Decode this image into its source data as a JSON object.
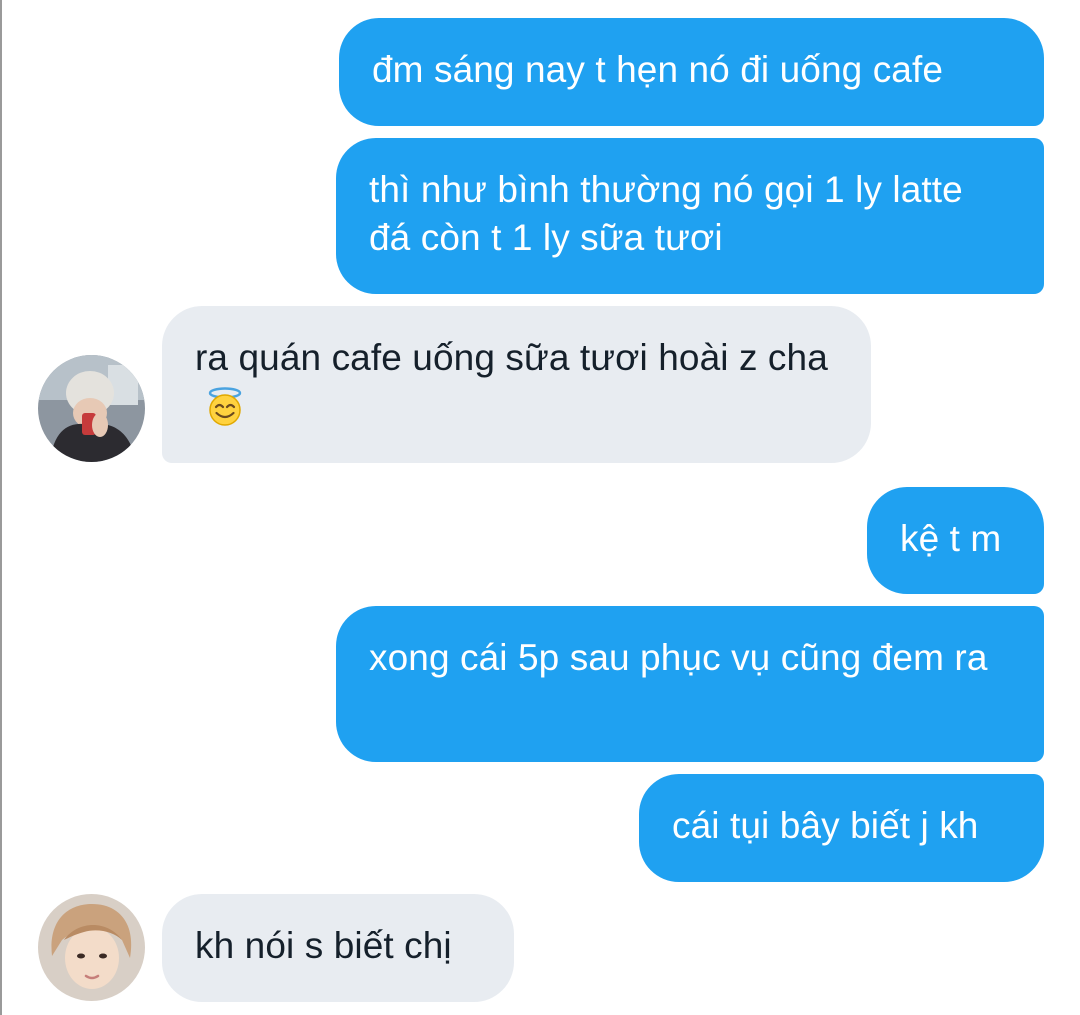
{
  "conversation": {
    "messages": [
      {
        "sender": "me",
        "text": "đm sáng nay t hẹn nó đi uống cafe"
      },
      {
        "sender": "me",
        "text": "thì như bình thường nó gọi 1 ly latte đá còn t 1 ly sữa tươi"
      },
      {
        "sender": "friend1",
        "text": "ra quán cafe uống sữa tươi hoài z cha",
        "emoji": "smiling-face-with-halo-emoji"
      },
      {
        "sender": "me",
        "text": "kệ t m"
      },
      {
        "sender": "me",
        "text": "xong cái 5p sau phục vụ cũng đem ra"
      },
      {
        "sender": "me",
        "text": "cái tụi bây biết j kh"
      },
      {
        "sender": "friend2",
        "text": "kh nói s biết chị"
      }
    ]
  },
  "colors": {
    "outgoing_bubble": "#1fa1f1",
    "outgoing_text": "#ffffff",
    "incoming_bubble": "#e8ecf1",
    "incoming_text": "#15202b",
    "background": "#ffffff"
  }
}
